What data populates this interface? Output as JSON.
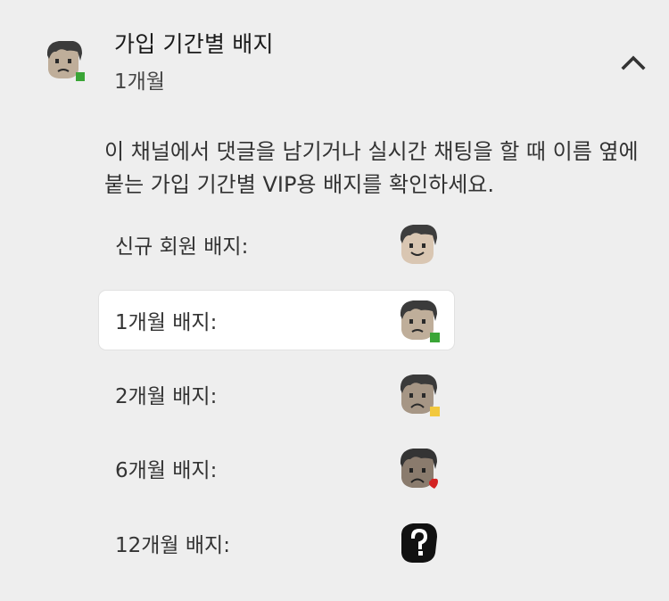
{
  "header": {
    "title": "가입 기간별 배지",
    "subtitle": "1개월",
    "avatar_icon": "face-1-month-badge",
    "collapse_icon": "chevron-up-icon"
  },
  "description": "이 채널에서 댓글을 남기거나 실시간 채팅을 할 때 이름 옆에 붙는 가입 기간별 VIP용 배지를 확인하세요.",
  "badges": [
    {
      "label": "신규 회원 배지:",
      "icon": "new-member-badge-icon",
      "selected": false
    },
    {
      "label": "1개월 배지:",
      "icon": "one-month-badge-icon",
      "selected": true
    },
    {
      "label": "2개월 배지:",
      "icon": "two-month-badge-icon",
      "selected": false
    },
    {
      "label": "6개월 배지:",
      "icon": "six-month-badge-icon",
      "selected": false
    },
    {
      "label": "12개월 배지:",
      "icon": "twelve-month-badge-icon",
      "selected": false
    }
  ],
  "colors": {
    "background": "#eeeeee",
    "selected_row": "#ffffff",
    "green_marker": "#3aa536",
    "yellow_marker": "#f2c83d",
    "red_heart": "#d32222"
  }
}
